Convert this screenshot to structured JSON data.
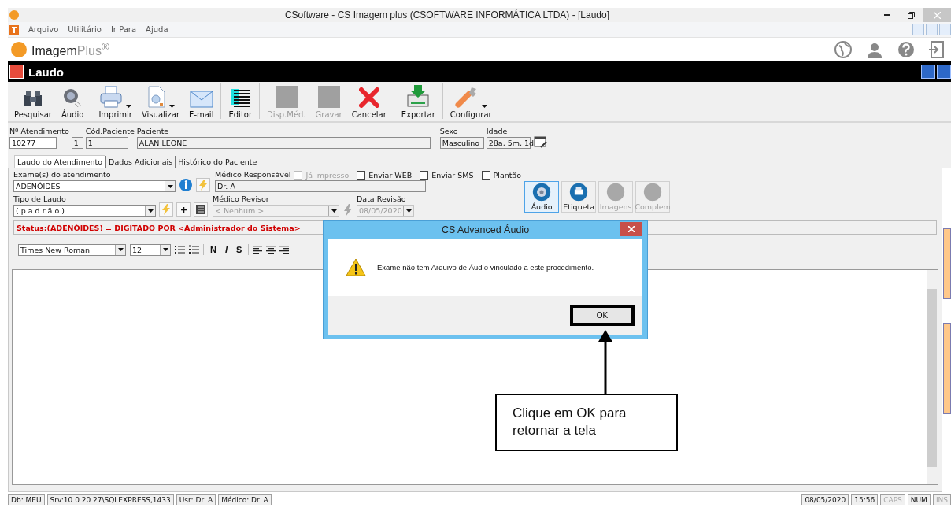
{
  "window": {
    "title": "CSoftware - CS Imagem plus (CSOFTWARE INFORMÁTICA LTDA) - [Laudo]"
  },
  "menu": [
    "Arquivo",
    "Utilitário",
    "Ir Para",
    "Ajuda"
  ],
  "logo": {
    "name": "Imagem",
    "suffix": "Plus$^{®}$"
  },
  "module_title": "Laudo",
  "toolbar": [
    {
      "label": "Pesquisar",
      "disabled": false,
      "dropdown": false,
      "separator_after": false
    },
    {
      "label": "Áudio",
      "disabled": false,
      "dropdown": false,
      "separator_after": true
    },
    {
      "label": "Imprimir",
      "disabled": false,
      "dropdown": true,
      "separator_after": false
    },
    {
      "label": "Visualizar",
      "disabled": false,
      "dropdown": true,
      "separator_after": false
    },
    {
      "label": "E-mail",
      "disabled": false,
      "dropdown": false,
      "separator_after": true
    },
    {
      "label": "Editor",
      "disabled": false,
      "dropdown": false,
      "separator_after": true
    },
    {
      "label": "Disp.Méd.",
      "disabled": true,
      "dropdown": false,
      "separator_after": false
    },
    {
      "label": "Gravar",
      "disabled": true,
      "dropdown": false,
      "separator_after": false
    },
    {
      "label": "Cancelar",
      "disabled": false,
      "dropdown": false,
      "separator_after": true
    },
    {
      "label": "Exportar",
      "disabled": false,
      "dropdown": false,
      "separator_after": true
    },
    {
      "label": "Configurar",
      "disabled": false,
      "dropdown": true,
      "separator_after": false
    }
  ],
  "patient_fields": [
    {
      "label": "Nº Atendimento",
      "value": "10277",
      "kind": "number"
    },
    {
      "value": "1",
      "kind": "tiny"
    },
    {
      "label": "Cód.Paciente",
      "value": "1",
      "kind": "code"
    },
    {
      "label": "Paciente",
      "value": "ALAN LEONE",
      "kind": "name"
    },
    {
      "label": "Sexo",
      "value": "Masculino",
      "kind": "sex"
    },
    {
      "label": "Idade",
      "value": "28a, 5m, 1d",
      "kind": "age"
    }
  ],
  "tabs": [
    {
      "label": "Laudo do Atendimento",
      "selected": true
    },
    {
      "label": "Dados Adicionais",
      "selected": false
    },
    {
      "label": "Histórico do Paciente",
      "selected": false
    }
  ],
  "form": {
    "exam": {
      "label": "Exame(s) do atendimento",
      "value": "ADENÓIDES"
    },
    "responsible": {
      "label": "Médico Responsável",
      "value": "Dr. A"
    },
    "checkboxes": [
      {
        "label": "Já impresso",
        "checked": false,
        "disabled": true
      },
      {
        "label": "Enviar WEB",
        "checked": false,
        "disabled": false
      },
      {
        "label": "Enviar SMS",
        "checked": false,
        "disabled": false
      },
      {
        "label": "Plantão",
        "checked": false,
        "disabled": false
      }
    ],
    "report_type": {
      "label": "Tipo de Laudo",
      "value": "( p a d r ã o )"
    },
    "reviewer": {
      "label": "Médico Revisor",
      "placeholder": "< Nenhum >",
      "disabled": true
    },
    "review_date": {
      "label": "Data Revisão",
      "value": "08/05/2020",
      "disabled": true
    },
    "status": "Status:(ADENÓIDES) = DIGITADO POR <Administrador do Sistema>"
  },
  "side_buttons": [
    {
      "label": "Áudio",
      "disabled": false,
      "selected": true
    },
    {
      "label": "Etiqueta",
      "disabled": false,
      "selected": false
    },
    {
      "label": "Imagens",
      "disabled": true,
      "selected": false
    },
    {
      "label": "Complem",
      "disabled": true,
      "selected": false
    }
  ],
  "format_bar": {
    "font": "Times New Roman",
    "size": "12",
    "styles": [
      {
        "label": "N",
        "kind": "bold"
      },
      {
        "label": "I",
        "kind": "italic"
      },
      {
        "label": "S",
        "kind": "underline"
      }
    ]
  },
  "dialog": {
    "title": "CS Advanced Áudio",
    "message": "Exame não tem Arquivo de Áudio vinculado a este procedimento.",
    "button": "OK"
  },
  "callout": "Clique em OK para retornar a tela",
  "status_bar": {
    "left": [
      "Db: MEU",
      "Srv:10.0.20.27\\SQLEXPRESS,1433",
      "Usr: Dr. A",
      "Médico: Dr. A"
    ],
    "right": [
      {
        "text": "08/05/2020",
        "disabled": false
      },
      {
        "text": "15:56",
        "disabled": false
      },
      {
        "text": "CAPS",
        "disabled": true
      },
      {
        "text": "NUM",
        "disabled": false
      },
      {
        "text": "INS",
        "disabled": true
      }
    ]
  }
}
